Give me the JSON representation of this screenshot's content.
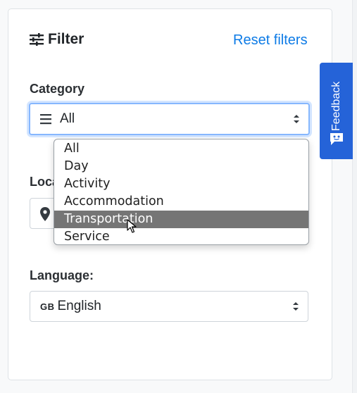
{
  "filter": {
    "title": "Filter",
    "reset_label": "Reset filters"
  },
  "category": {
    "label": "Category",
    "selected": "All",
    "options": [
      "All",
      "Day",
      "Activity",
      "Accommodation",
      "Transportation",
      "Service"
    ],
    "highlighted_option": "Transportation"
  },
  "location": {
    "label_visible": "Loca"
  },
  "language": {
    "label": "Language:",
    "flag": "GB",
    "selected": "English"
  },
  "feedback": {
    "label": "Feedback"
  },
  "colors": {
    "accent": "#0d7be6",
    "feedback_bg": "#2563d8",
    "highlight_bg": "#757575"
  }
}
